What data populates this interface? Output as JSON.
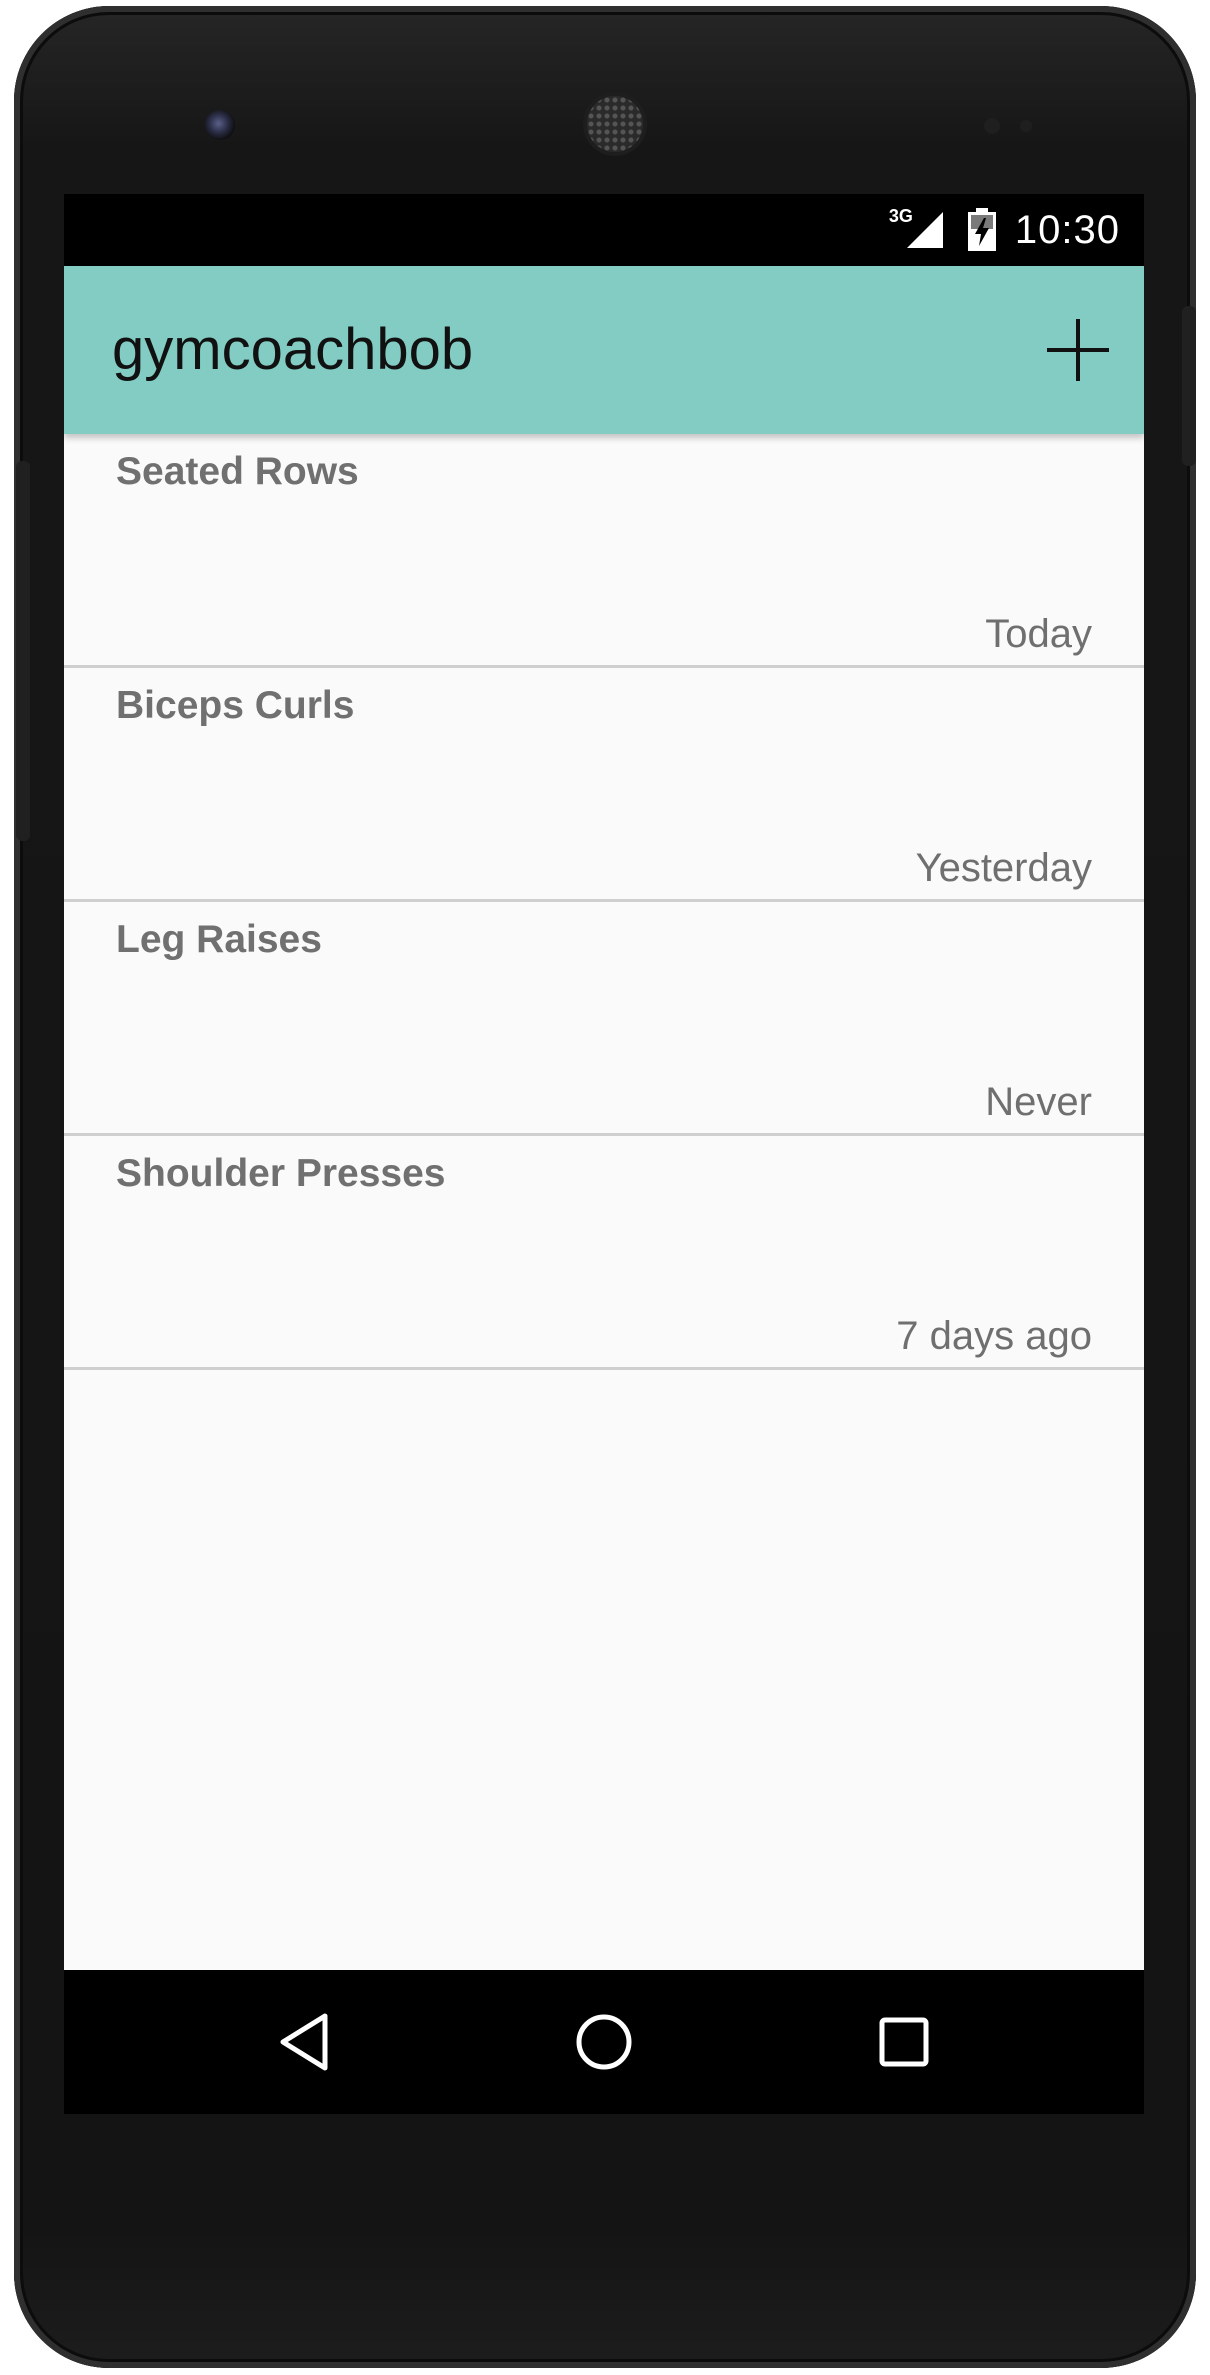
{
  "status_bar": {
    "network": "3G",
    "time": "10:30",
    "signal_icon": "cell-signal-icon",
    "battery_icon": "battery-charging-icon"
  },
  "app_bar": {
    "title": "gymcoachbob",
    "add_icon": "plus-icon",
    "background": "#82ccc3"
  },
  "exercises": [
    {
      "name": "Seated Rows",
      "last_done": "Today"
    },
    {
      "name": "Biceps Curls",
      "last_done": "Yesterday"
    },
    {
      "name": "Leg Raises",
      "last_done": "Never"
    },
    {
      "name": "Shoulder Presses",
      "last_done": "7 days ago"
    }
  ],
  "nav_bar": {
    "back_icon": "back-triangle-icon",
    "home_icon": "home-circle-icon",
    "recents_icon": "recents-square-icon"
  }
}
